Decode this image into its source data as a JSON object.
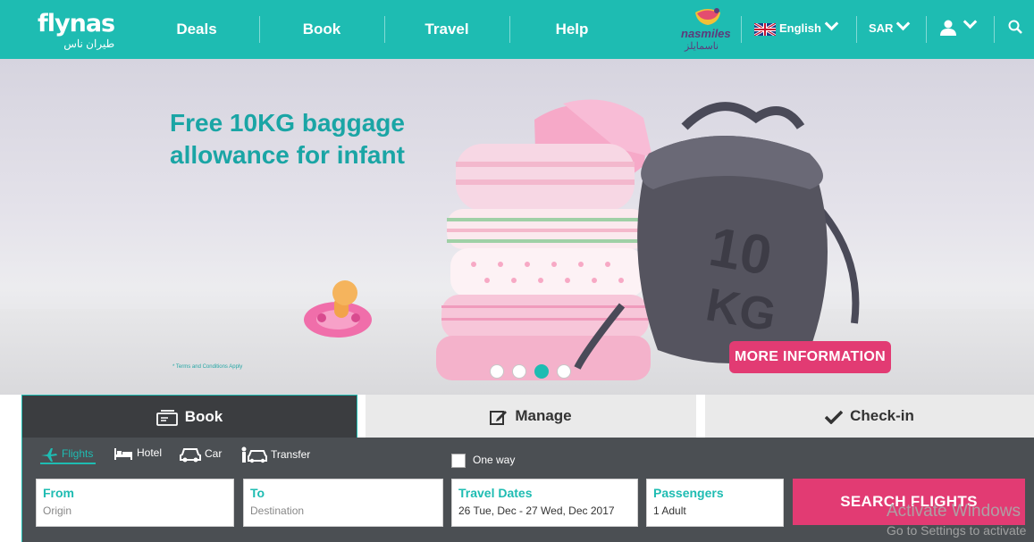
{
  "header": {
    "logo_en": "flynas",
    "logo_ar": "طيران ناس",
    "nav": [
      "Deals",
      "Book",
      "Travel",
      "Help"
    ],
    "loyalty_en": "nasmiles",
    "loyalty_ar": "ناسمايلز",
    "language": "English",
    "currency": "SAR"
  },
  "hero": {
    "title_line1": "Free 10KG baggage",
    "title_line2": "allowance for infant",
    "terms": "* Terms and Conditions Apply",
    "bag_text_1": "10",
    "bag_text_2": "KG",
    "cta": "MORE INFORMATION",
    "slide_count": 4,
    "active_slide": 3
  },
  "booking": {
    "tabs": [
      "Book",
      "Manage",
      "Check-in"
    ],
    "active_tab": "Book",
    "subtabs": [
      "Flights",
      "Hotel",
      "Car",
      "Transfer"
    ],
    "active_subtab": "Flights",
    "one_way_label": "One way",
    "one_way_checked": false,
    "from": {
      "label": "From",
      "placeholder": "Origin"
    },
    "to": {
      "label": "To",
      "placeholder": "Destination"
    },
    "dates": {
      "label": "Travel Dates",
      "value": "26 Tue, Dec - 27 Wed, Dec 2017"
    },
    "passengers": {
      "label": "Passengers",
      "value": "1 Adult"
    },
    "search_label": "SEARCH FLIGHTS"
  },
  "os_watermark": {
    "line1": "Activate Windows",
    "line2": "Go to Settings to activate"
  },
  "colors": {
    "brand_teal": "#1ebcb2",
    "cta_pink": "#e23b73",
    "panel_dark": "#4b4f53"
  }
}
